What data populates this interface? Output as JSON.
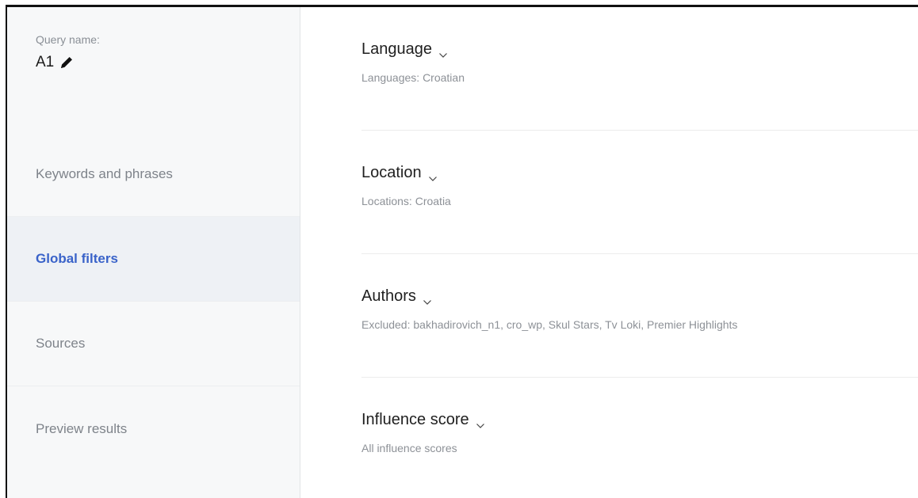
{
  "sidebar": {
    "query_label": "Query name:",
    "query_name": "A1",
    "nav": [
      {
        "label": "Keywords and phrases"
      },
      {
        "label": "Global filters"
      },
      {
        "label": "Sources"
      },
      {
        "label": "Preview results"
      }
    ],
    "active_nav": "Global filters"
  },
  "filters": [
    {
      "title": "Language",
      "summary": "Languages: Croatian"
    },
    {
      "title": "Location",
      "summary": "Locations: Croatia"
    },
    {
      "title": "Authors",
      "summary": "Excluded: bakhadirovich_n1, cro_wp, Skul Stars, Tv Loki, Premier Highlights"
    },
    {
      "title": "Influence score",
      "summary": "All influence scores"
    }
  ],
  "colors": {
    "accent": "#3a63c9",
    "sidebar_bg": "#f7f8f9",
    "active_bg": "#eef1f5"
  },
  "icons": {
    "edit": "pencil-icon",
    "expand": "chevron-down-icon"
  }
}
